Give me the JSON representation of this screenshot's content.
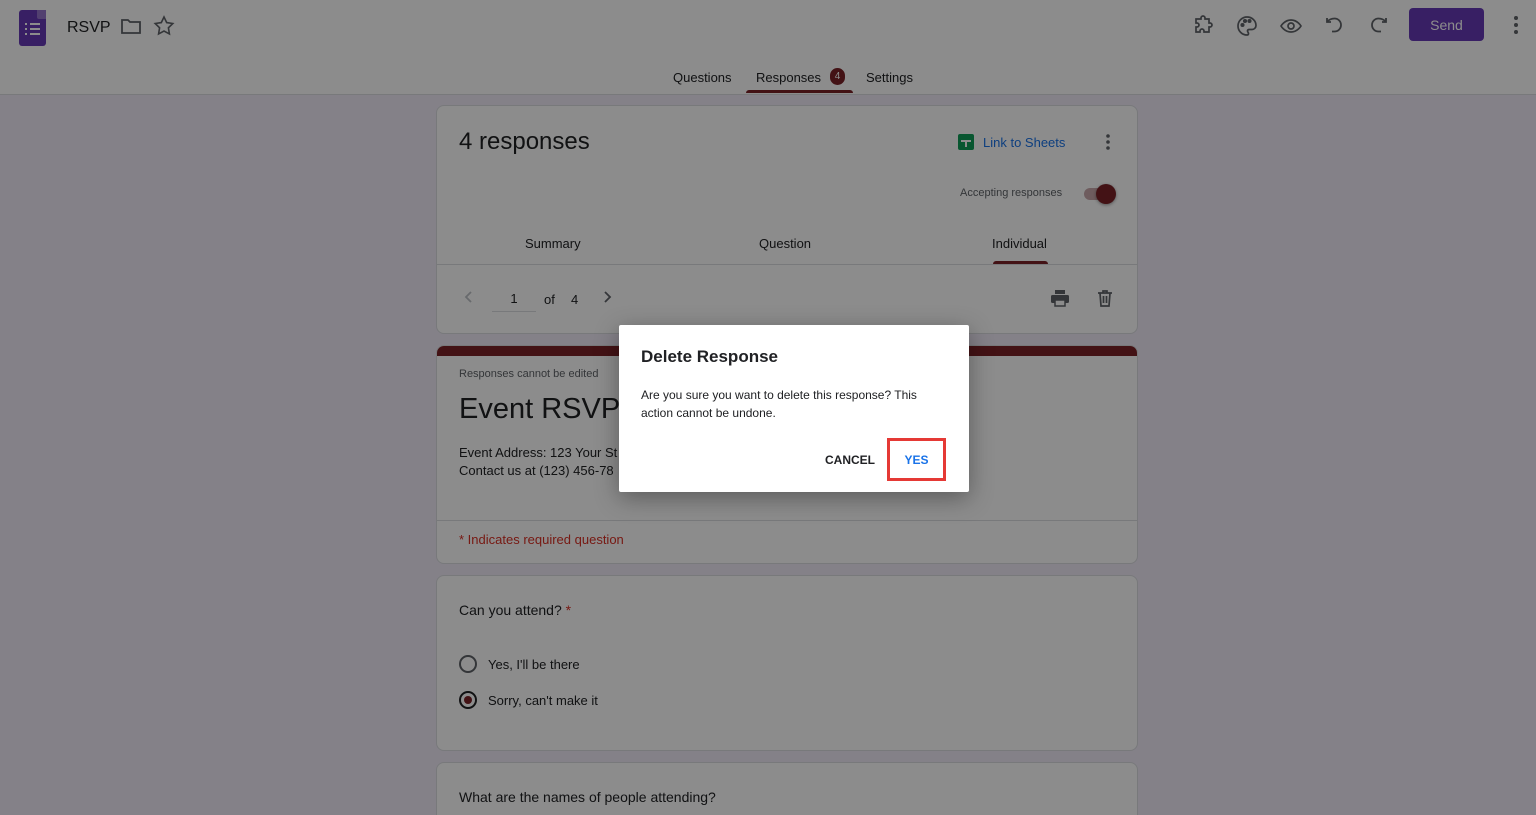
{
  "header": {
    "doc_title": "RSVP",
    "send_label": "Send",
    "icons": [
      "addon-icon",
      "palette-icon",
      "preview-eye-icon",
      "undo-icon",
      "redo-icon",
      "more-vert-icon"
    ]
  },
  "tabs": {
    "questions": "Questions",
    "responses": "Responses",
    "responses_badge": "4",
    "settings": "Settings"
  },
  "responses_card": {
    "count_text": "4 responses",
    "link_to_sheets": "Link to Sheets",
    "accepting_label": "Accepting responses",
    "accepting_on": true,
    "subtabs": {
      "summary": "Summary",
      "question": "Question",
      "individual": "Individual"
    },
    "pager": {
      "current": "1",
      "of": "of",
      "total": "4"
    }
  },
  "form": {
    "cannot_edit": "Responses cannot be edited",
    "title": "Event RSVP",
    "desc_line1": "Event Address: 123 Your St",
    "desc_line2": "Contact us at (123) 456-78",
    "required_note": "* Indicates required question"
  },
  "question1": {
    "title": "Can you attend?",
    "required_mark": "*",
    "options": [
      "Yes, I'll be there",
      "Sorry, can't make it"
    ],
    "selected_index": 1
  },
  "question2": {
    "title": "What are the names of people attending?"
  },
  "dialog": {
    "title": "Delete Response",
    "body": "Are you sure you want to delete this response? This action cannot be undone.",
    "cancel": "CANCEL",
    "yes": "YES"
  },
  "colors": {
    "primary": "#673ab7",
    "theme": "#7b2227",
    "link": "#1a73e8",
    "required": "#d93025",
    "highlight_box": "#e53935"
  }
}
